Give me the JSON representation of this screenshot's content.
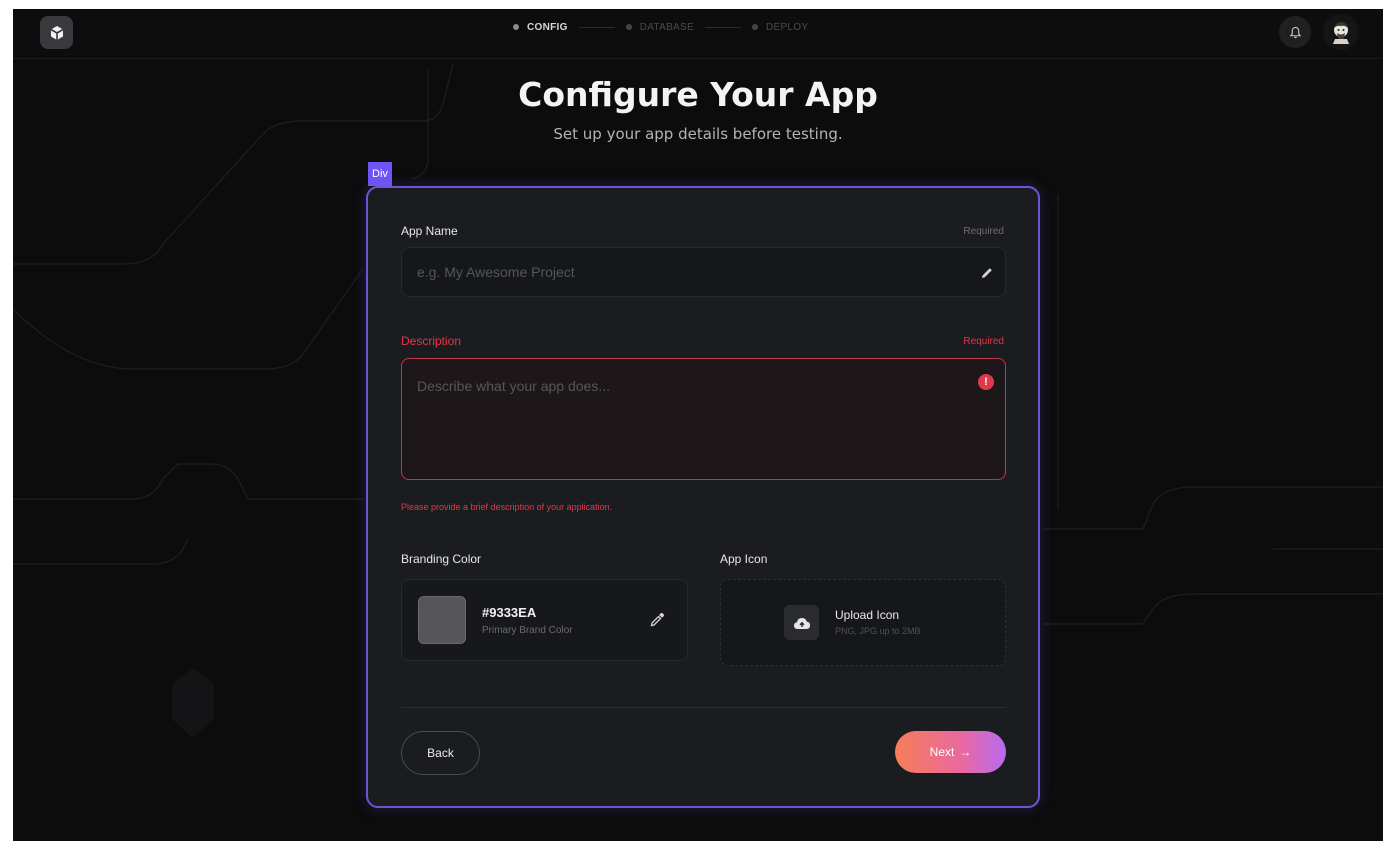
{
  "topbar": {
    "logo_icon": "cube-icon",
    "steps": [
      {
        "label": "CONFIG",
        "active": true
      },
      {
        "label": "DATABASE",
        "active": false
      },
      {
        "label": "DEPLOY",
        "active": false
      }
    ],
    "notification_icon": "bell-icon",
    "avatar_icon": "avatar-icon"
  },
  "header": {
    "title": "Configure Your App",
    "subtitle": "Set up your app details before testing."
  },
  "debug_tag": "Div",
  "form": {
    "app_name": {
      "label": "App Name",
      "required_text": "Required",
      "placeholder": "e.g. My Awesome Project",
      "value": ""
    },
    "description": {
      "label": "Description",
      "required_text": "Required",
      "placeholder": "Describe what your app does...",
      "value": "",
      "error_icon": "!",
      "error_message": "Please provide a brief description of your application."
    },
    "branding": {
      "label": "Branding Color",
      "hex": "#9333EA",
      "sub": "Primary Brand Color"
    },
    "app_icon": {
      "label": "App Icon",
      "upload_title": "Upload Icon",
      "upload_sub": "PNG, JPG up to 2MB"
    }
  },
  "actions": {
    "back_label": "Back",
    "next_label": "Next",
    "next_arrow": "→"
  },
  "colors": {
    "accent_border": "#6b56d6",
    "error": "#e0394a",
    "next_gradient_start": "#f77d57",
    "next_gradient_end": "#b86af1"
  }
}
